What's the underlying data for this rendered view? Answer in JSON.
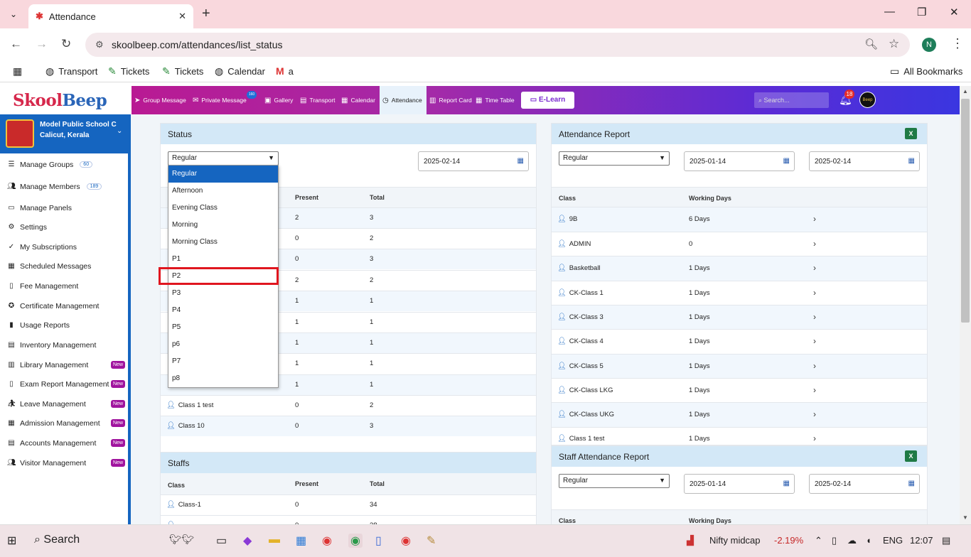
{
  "browser": {
    "tab_title": "Attendance",
    "url": "skoolbeep.com/attendances/list_status",
    "profile_initial": "N",
    "bookmarks": [
      "Transport",
      "Tickets",
      "Tickets",
      "Calendar",
      "a"
    ],
    "all_bookmarks": "All Bookmarks"
  },
  "header": {
    "logo_a": "Skool",
    "logo_b": "Beep",
    "nav": [
      "Group Message",
      "Private Message",
      "Gallery",
      "Transport",
      "Calendar",
      "Attendance",
      "Report Card",
      "Time Table"
    ],
    "private_badge": "160",
    "elearn": "E-Learn",
    "search_placeholder": "Search...",
    "notif_count": "18",
    "avatar_text": "Beep"
  },
  "sidebar": {
    "school_name": "Model Public School C",
    "school_place": "Calicut, Kerala",
    "items": [
      {
        "label": "Manage Groups",
        "count": "60",
        "new": ""
      },
      {
        "label": "Manage Members",
        "count": "189",
        "new": ""
      },
      {
        "label": "Manage Panels",
        "count": "",
        "new": ""
      },
      {
        "label": "Settings",
        "count": "",
        "new": ""
      },
      {
        "label": "My Subscriptions",
        "count": "",
        "new": ""
      },
      {
        "label": "Scheduled Messages",
        "count": "",
        "new": ""
      },
      {
        "label": "Fee Management",
        "count": "",
        "new": ""
      },
      {
        "label": "Certificate Management",
        "count": "",
        "new": ""
      },
      {
        "label": "Usage Reports",
        "count": "",
        "new": ""
      },
      {
        "label": "Inventory Management",
        "count": "",
        "new": ""
      },
      {
        "label": "Library Management",
        "count": "",
        "new": "New"
      },
      {
        "label": "Exam Report Management",
        "count": "",
        "new": "New"
      },
      {
        "label": "Leave Management",
        "count": "",
        "new": "New"
      },
      {
        "label": "Admission Management",
        "count": "",
        "new": "New"
      },
      {
        "label": "Accounts Management",
        "count": "",
        "new": "New"
      },
      {
        "label": "Visitor Management",
        "count": "",
        "new": "New"
      }
    ]
  },
  "status_card": {
    "title": "Status",
    "selected": "Regular",
    "date": "2025-02-14",
    "col_present": "Present",
    "col_total": "Total",
    "rows": [
      {
        "cls": "",
        "present": "2",
        "total": "3"
      },
      {
        "cls": "",
        "present": "0",
        "total": "2"
      },
      {
        "cls": "",
        "present": "0",
        "total": "3"
      },
      {
        "cls": "",
        "present": "2",
        "total": "2"
      },
      {
        "cls": "",
        "present": "1",
        "total": "1"
      },
      {
        "cls": "",
        "present": "1",
        "total": "1"
      },
      {
        "cls": "",
        "present": "1",
        "total": "1"
      },
      {
        "cls": "",
        "present": "1",
        "total": "1"
      },
      {
        "cls": "",
        "present": "1",
        "total": "1"
      },
      {
        "cls": "Class 1 test",
        "present": "0",
        "total": "2"
      },
      {
        "cls": "Class 10",
        "present": "0",
        "total": "3"
      }
    ]
  },
  "dropdown": {
    "options": [
      "Regular",
      "Afternoon",
      "Evening Class",
      "Morning",
      "Morning Class",
      "P1",
      "P2",
      "P3",
      "P4",
      "P5",
      "p6",
      "P7",
      "p8"
    ]
  },
  "staffs_card": {
    "title": "Staffs",
    "col_class": "Class",
    "col_present": "Present",
    "col_total": "Total",
    "rows": [
      {
        "cls": "Class-1",
        "present": "0",
        "total": "34"
      },
      {
        "cls": "",
        "present": "0",
        "total": "38"
      }
    ]
  },
  "report_card": {
    "title": "Attendance Report",
    "selected": "Regular",
    "from": "2025-01-14",
    "to": "2025-02-14",
    "col_class": "Class",
    "col_days": "Working Days",
    "rows": [
      {
        "cls": "9B",
        "days": "6 Days"
      },
      {
        "cls": "ADMIN",
        "days": "0"
      },
      {
        "cls": "Basketball",
        "days": "1 Days"
      },
      {
        "cls": "CK-Class 1",
        "days": "1 Days"
      },
      {
        "cls": "CK-Class 3",
        "days": "1 Days"
      },
      {
        "cls": "CK-Class 4",
        "days": "1 Days"
      },
      {
        "cls": "CK-Class 5",
        "days": "1 Days"
      },
      {
        "cls": "CK-Class LKG",
        "days": "1 Days"
      },
      {
        "cls": "CK-Class UKG",
        "days": "1 Days"
      },
      {
        "cls": "Class 1 test",
        "days": "1 Days"
      }
    ]
  },
  "staff_report_card": {
    "title": "Staff Attendance Report",
    "selected": "Regular",
    "from": "2025-01-14",
    "to": "2025-02-14",
    "col_class": "Class",
    "col_days": "Working Days"
  },
  "taskbar": {
    "search": "Search",
    "ticker_name": "Nifty midcap",
    "ticker_value": "-2.19%",
    "lang": "ENG",
    "time": "12:07"
  }
}
